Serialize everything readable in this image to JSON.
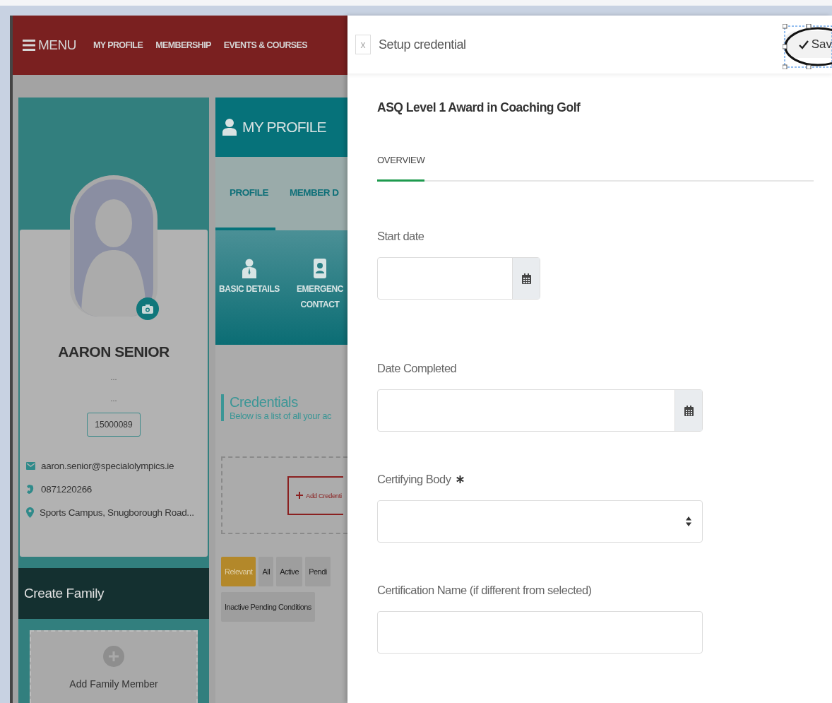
{
  "nav": {
    "menu_label": "MENU",
    "items": [
      "MY PROFILE",
      "MEMBERSHIP",
      "EVENTS & COURSES"
    ]
  },
  "profile_card": {
    "name": "AARON SENIOR",
    "subtitle_lines": [
      "...",
      "..."
    ],
    "member_id": "15000089",
    "contacts": [
      {
        "kind": "email",
        "text": "aaron.senior@specialolympics.ie"
      },
      {
        "kind": "phone",
        "text": "0871220266"
      },
      {
        "kind": "address",
        "text": "Sports Campus, Snugborough Road..."
      }
    ]
  },
  "family": {
    "title": "Create Family",
    "add_label": "Add Family Member"
  },
  "profile_panel": {
    "title": "MY PROFILE",
    "tabs": [
      {
        "label": "PROFILE",
        "selected": true
      },
      {
        "label": "MEMBER D",
        "selected": false
      }
    ],
    "sections": [
      {
        "kind": "person",
        "lines": [
          "BASIC DETAILS"
        ]
      },
      {
        "kind": "contact",
        "lines": [
          "EMERGENC",
          "CONTACT"
        ]
      }
    ]
  },
  "credentials": {
    "title": "Credentials",
    "description": "Below is a list of all your ac",
    "add_button": "Add Credenti",
    "filters": [
      {
        "label": "Relevant",
        "selected": true
      },
      {
        "label": "All",
        "selected": false
      },
      {
        "label": "Active",
        "selected": false
      },
      {
        "label": "Pendi",
        "selected": false
      },
      {
        "label": "Inactive Pending Conditions",
        "selected": false
      }
    ]
  },
  "drawer": {
    "close_label": "x",
    "title": "Setup credential",
    "save_label": "Sav",
    "heading": "ASQ Level 1 Award in Coaching Golf",
    "tabs": [
      {
        "label": "OVERVIEW",
        "selected": true
      }
    ],
    "fields": [
      {
        "label": "Start date",
        "kind": "shortdate",
        "required": false
      },
      {
        "label": "Date Completed",
        "kind": "date",
        "required": false
      },
      {
        "label": "Certifying Body",
        "kind": "select",
        "required": true
      },
      {
        "label": "Certification Name (if different from selected)",
        "kind": "text",
        "required": false
      }
    ]
  }
}
